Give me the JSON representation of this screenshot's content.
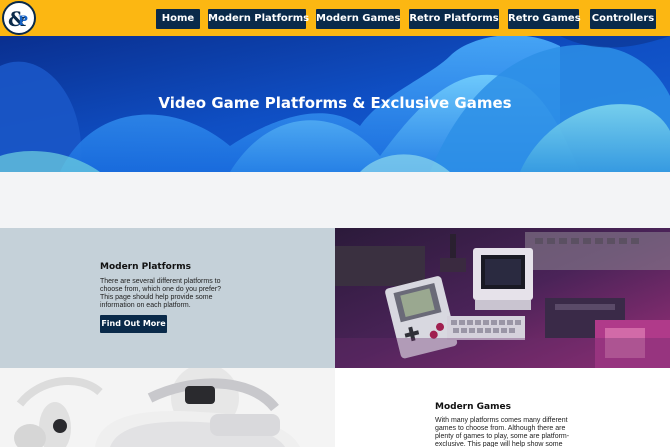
{
  "header": {
    "logo_label": "Video game platforms logo",
    "nav": [
      "Home",
      "Modern Platforms",
      "Modern Games",
      "Retro Platforms",
      "Retro Games",
      "Controllers"
    ]
  },
  "hero": {
    "title": "Video Game Platforms & Exclusive Games"
  },
  "sections": [
    {
      "heading": "Modern Platforms",
      "text": "There are several different platforms to choose from, which one do you prefer? This page should help provide some information on each platform.",
      "button": "Find Out More",
      "image": "retro consoles and handheld game devices in neon light"
    },
    {
      "heading": "Modern Games",
      "text": "With many platforms comes many different games to choose from. Although there are plenty of games to play, some are platform-exclusive. This page will help show some of",
      "image": "virtual reality headset"
    }
  ],
  "colors": {
    "header_bg": "#fcb712",
    "nav_bg": "#0a2a4a",
    "hero_blue": "#1563c8",
    "section_gray": "#c5d1d9"
  }
}
